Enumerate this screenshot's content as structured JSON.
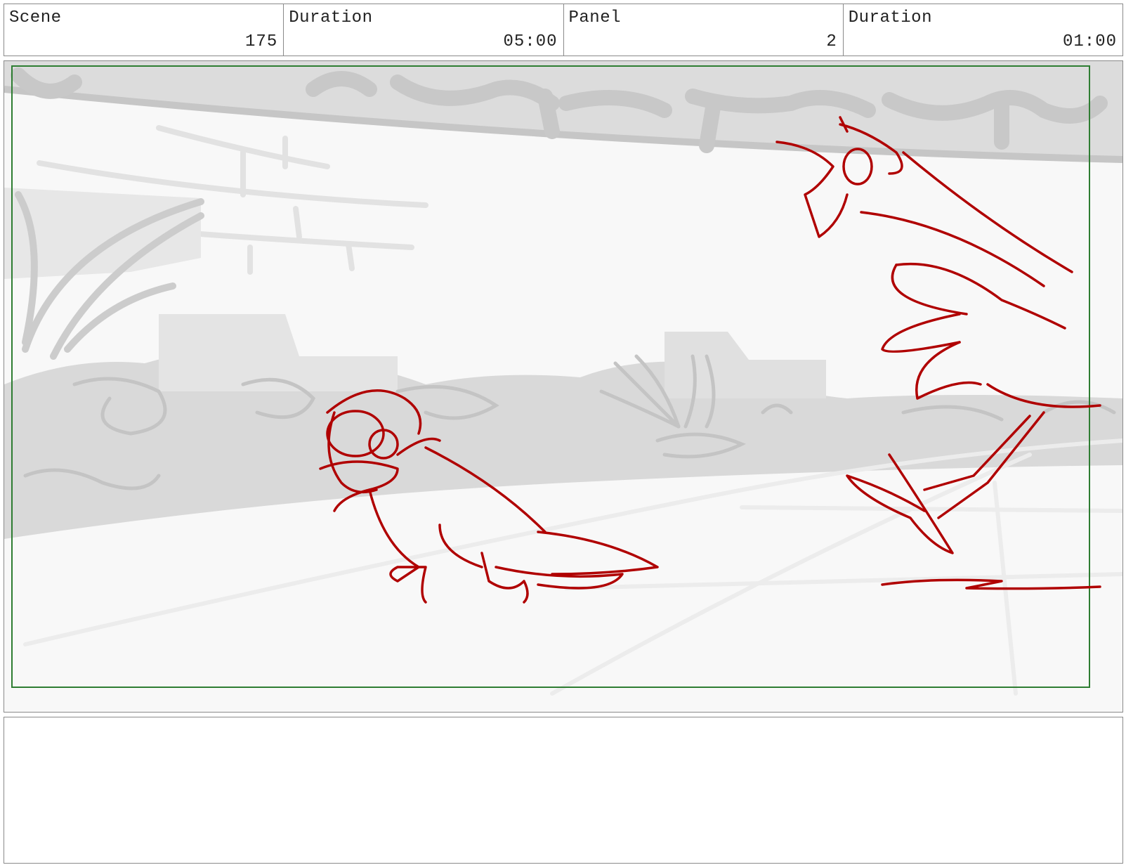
{
  "header": {
    "cells": [
      {
        "label": "Scene",
        "value": "175"
      },
      {
        "label": "Duration",
        "value": "05:00"
      },
      {
        "label": "Panel",
        "value": "2"
      },
      {
        "label": "Duration",
        "value": "01:00"
      }
    ]
  },
  "panel": {
    "safe_frame_color": "#2e7d32",
    "sketch_color": "#b00000",
    "background_tone": "#d6d6d6",
    "drawing": "storyboard-sketch"
  },
  "notes": {
    "text": ""
  }
}
